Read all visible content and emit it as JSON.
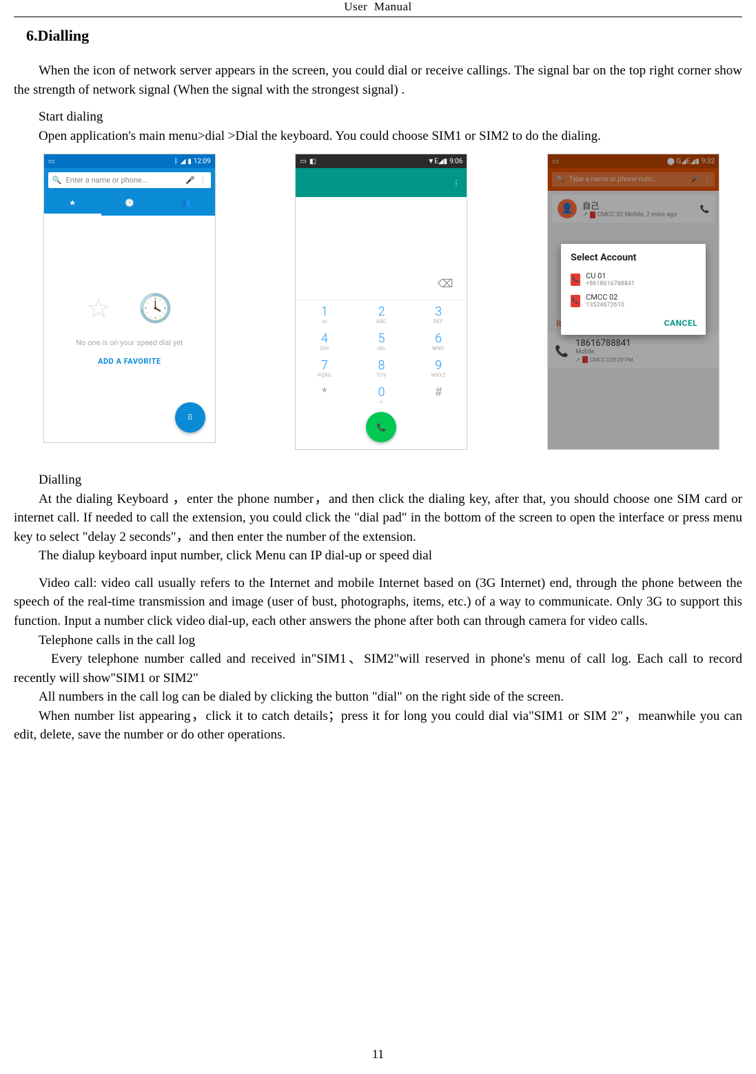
{
  "header": {
    "part1": "User",
    "part2": "Manual"
  },
  "title": "6.Dialling",
  "para1": "When the icon of network server appears in the screen, you could dial or receive callings. The signal bar on the top right corner show the strength of network signal (When the signal with the strongest signal) .",
  "start_dialing_label": "Start dialing",
  "para2": "Open application's main menu>dial >Dial the keyboard. You could choose SIM1 or SIM2 to do the dialing.",
  "screen1": {
    "time": "12:09",
    "search_placeholder": "Enter a name or phone...",
    "empty": "No one is on your speed dial yet",
    "add_favorite": "ADD A FAVORITE"
  },
  "screen2": {
    "time": "9:06",
    "status_right": "▼E◢▮",
    "keys": [
      [
        {
          "n": "1",
          "l": "∞"
        },
        {
          "n": "2",
          "l": "ABC"
        },
        {
          "n": "3",
          "l": "DEF"
        }
      ],
      [
        {
          "n": "4",
          "l": "GHI"
        },
        {
          "n": "5",
          "l": "JKL"
        },
        {
          "n": "6",
          "l": "MNO"
        }
      ],
      [
        {
          "n": "7",
          "l": "PQRS"
        },
        {
          "n": "8",
          "l": "TUV"
        },
        {
          "n": "9",
          "l": "WXYZ"
        }
      ],
      [
        {
          "n": "*",
          "l": ""
        },
        {
          "n": "0",
          "l": "+"
        },
        {
          "n": "#",
          "l": ""
        }
      ]
    ]
  },
  "screen3": {
    "time": "9:32",
    "status_right": "⬤ G◢E◢▮",
    "search_placeholder": "Type a name or phone num...",
    "self_name": "自己",
    "self_sub": "CMCC 02 Mobile, 2 mins ago",
    "recent_label": "Recent",
    "row_num": "18616788841",
    "row_sub": "Mobile",
    "row_meta": "CMCC 029:29 PM",
    "dialog": {
      "title": "Select Account",
      "item1_name": "CU 01",
      "item1_sub": "+8618616788841",
      "item2_name": "CMCC 02",
      "item2_sub": "13524672610",
      "cancel": "CANCEL"
    }
  },
  "dialling_heading": "Dialling",
  "para3": "At the dialing Keyboard ，enter the phone number，and then click the dialing key, after that, you should choose one SIM card or internet call. If needed to call the extension, you could click the \"dial pad\" in the bottom of the screen to open the interface or press menu key to select \"delay 2 seconds\"，and then enter the number of the extension.",
  "para4": "The dialup keyboard input number, click Menu can IP dial-up or speed dial",
  "para5": "Video call: video call usually refers to the Internet and mobile Internet based on (3G Internet) end, through the phone between the speech of the real-time transmission and image (user of bust, photographs, items, etc.) of a way to communicate. Only 3G to support this function. Input a number click video dial-up, each other answers the phone after both can through camera for video calls.",
  "calllog_heading": "Telephone calls in the call log",
  "para6": "Every telephone number called and received in\"SIM1、SIM2\"will reserved in phone's menu of call log. Each call to record recently will show\"SIM1 or SIM2\"",
  "para7": "All numbers in the call log can be dialed by clicking the button \"dial\" on the right side of the screen.",
  "para8": "When number list appearing，click it to catch details；press it for long you could dial via\"SIM1 or SIM 2\"，meanwhile you can edit, delete, save the number or do other operations.",
  "page_number": "11"
}
